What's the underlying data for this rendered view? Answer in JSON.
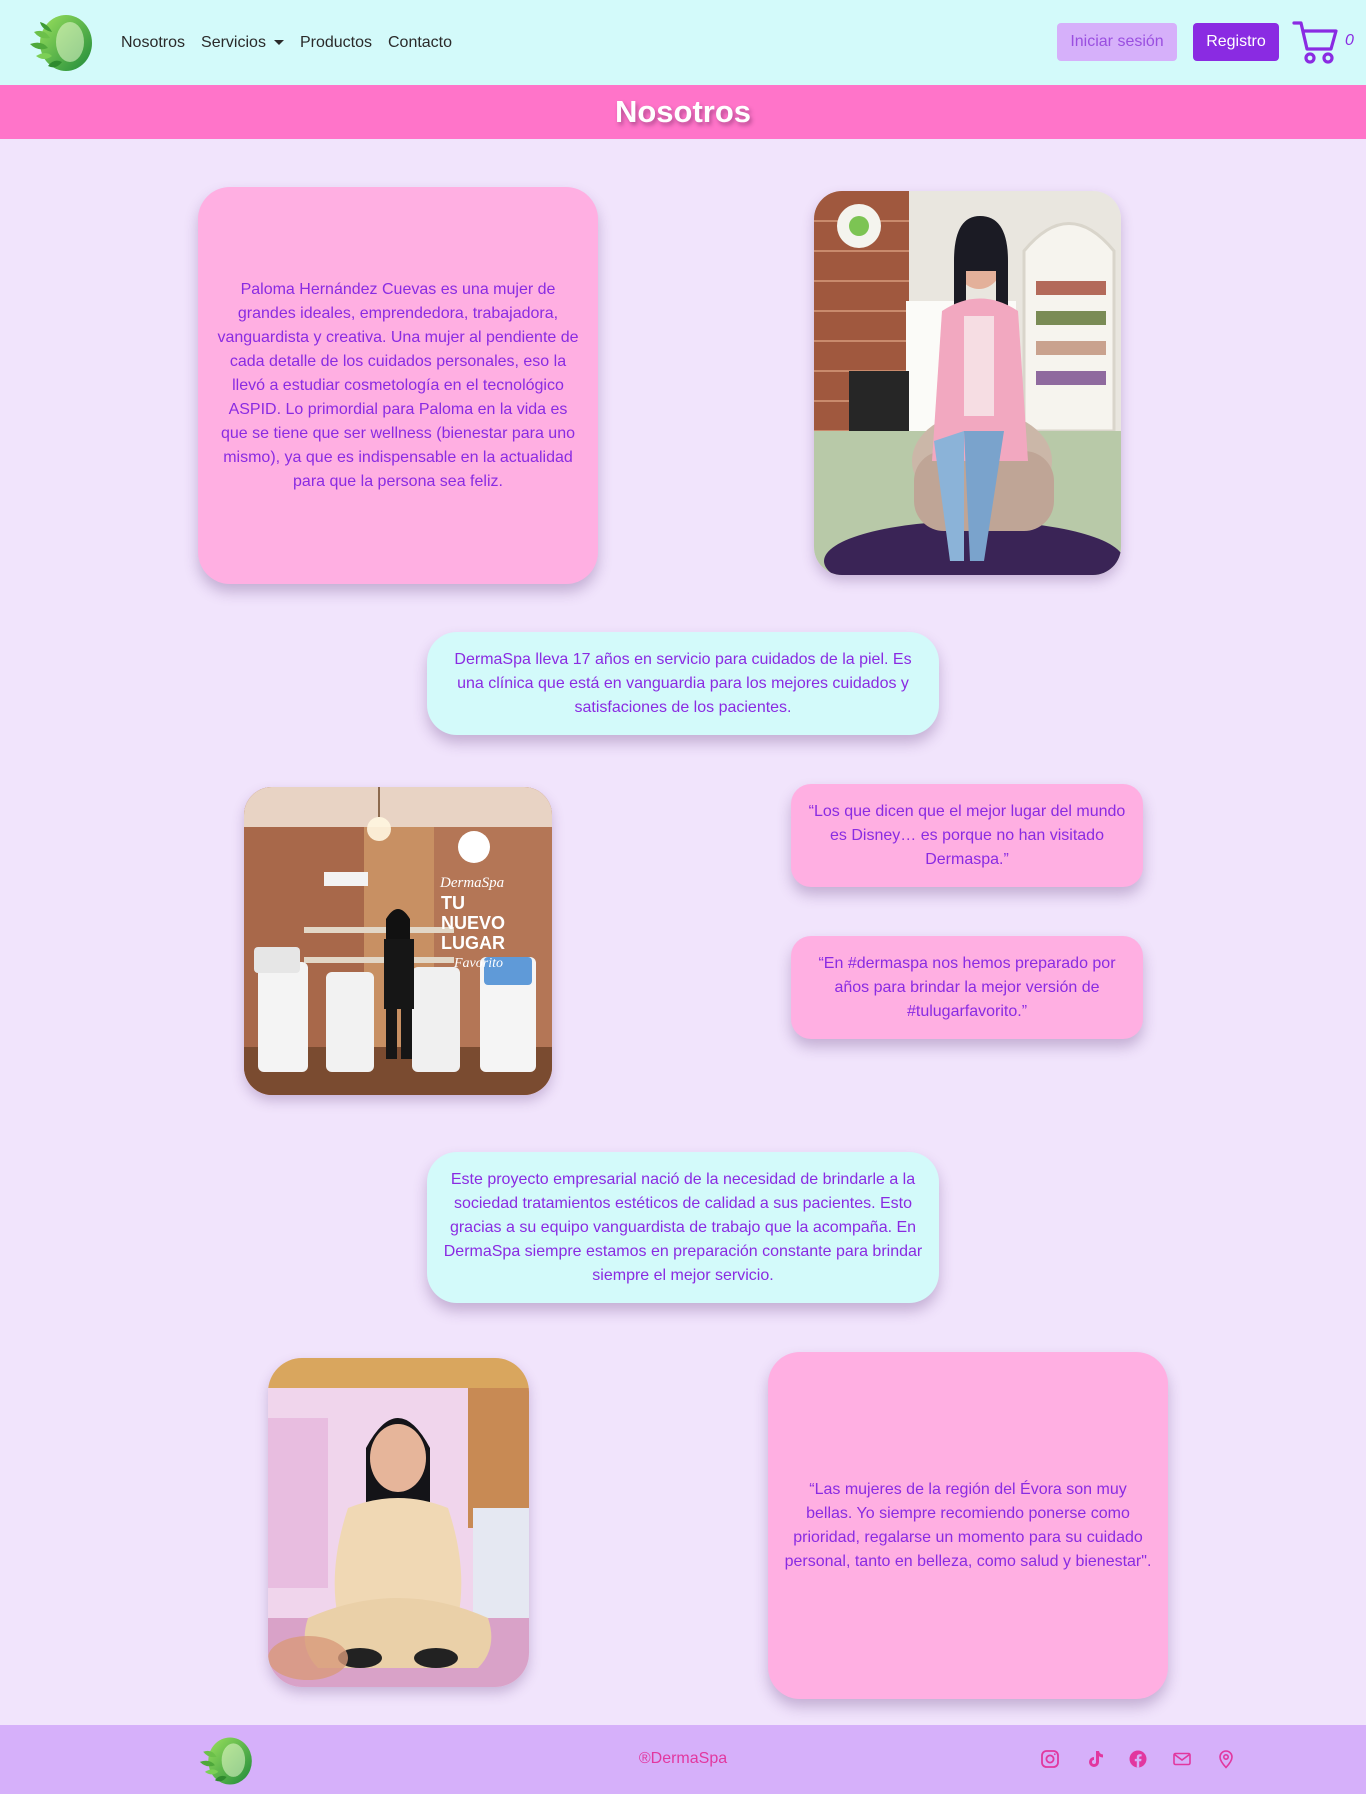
{
  "navbar": {
    "links": [
      "Nosotros",
      "Servicios",
      "Productos",
      "Contacto"
    ],
    "login_label": "Iniciar sesión",
    "register_label": "Registro",
    "cart_count": "0"
  },
  "banner": {
    "title": "Nosotros"
  },
  "sections": {
    "bio": "Paloma Hernández Cuevas es una mujer de grandes ideales, emprendedora, trabajadora, vanguardista y creativa. Una mujer al pendiente de cada detalle de los cuidados personales, eso la llevó a estudiar cosmetología en el tecnológico ASPID. Lo primordial para Paloma en la vida es que se tiene que ser wellness (bienestar para uno mismo), ya que es indispensable en la actualidad para que la persona sea feliz.",
    "years": "DermaSpa lleva 17 años en servicio para cuidados de la piel. Es una clínica que está en vanguardia para los mejores cuidados y satisfaciones de los pacientes.",
    "quote1": "“Los que dicen que el mejor lugar del mundo es Disney… es porque no han visitado Dermaspa.”",
    "quote2": "“En #dermaspa nos hemos preparado por años para brindar la mejor versión de #tulugarfavorito.”",
    "project": "Este proyecto empresarial nació de la necesidad de brindarle a la sociedad tratamientos estéticos de calidad a sus pacientes. Esto gracias a su equipo vanguardista de trabajo que la acompaña. En DermaSpa siempre estamos en preparación constante para brindar siempre el mejor servicio.",
    "quote3": "“Las mujeres de la región del Évora son muy bellas. Yo siempre recomiendo ponerse como prioridad, regalarse un momento para su cuidado personal, tanto en belleza, como salud y bienestar\"."
  },
  "photo2_sign": {
    "brand": "DermaSpa",
    "line1": "TU",
    "line2": "NUEVO",
    "line3": "LUGAR",
    "line4": "Favorito"
  },
  "footer": {
    "copyright": "®DermaSpa"
  },
  "icons": {
    "cart": "cart-icon",
    "social": [
      "instagram-icon",
      "tiktok-icon",
      "facebook-icon",
      "email-icon",
      "location-icon"
    ]
  },
  "colors": {
    "accent": "#8a2be2",
    "nav_bg": "#d3fafa",
    "banner_bg": "#ff74c9",
    "page_bg": "#f1e4fc",
    "card_pink": "#ffafe2",
    "card_cyan": "#d3fafa",
    "footer_bg": "#d6b0fa",
    "footer_text": "#e2379f"
  }
}
